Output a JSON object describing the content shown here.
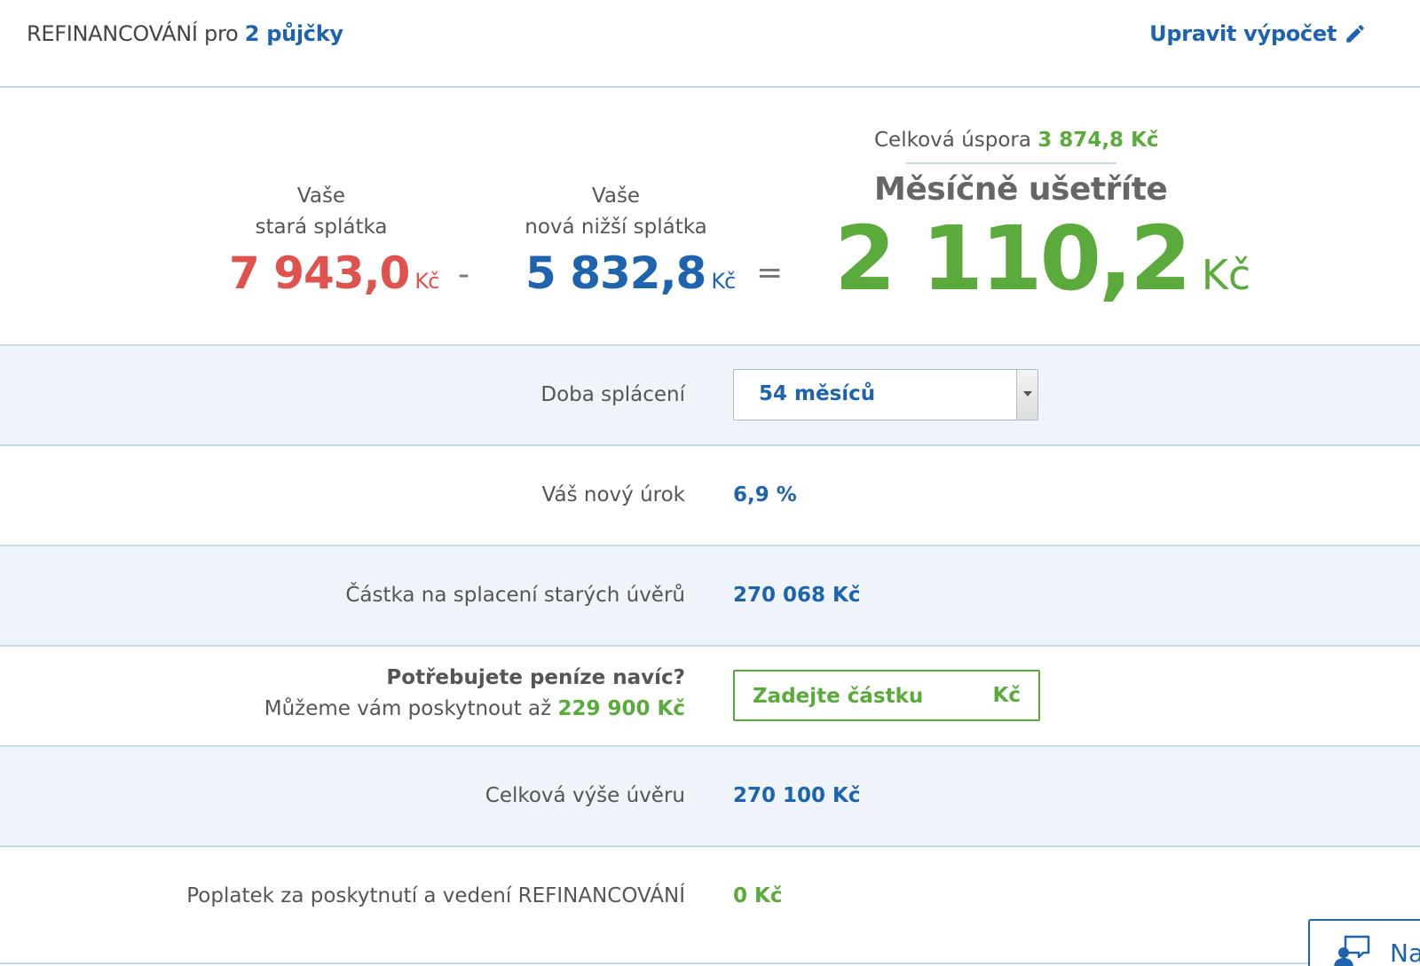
{
  "header": {
    "title_prefix": "REFINANCOVÁNÍ pro",
    "loan_count": "2 půjčky",
    "edit_label": "Upravit výpočet"
  },
  "summary": {
    "old": {
      "label_line1": "Vaše",
      "label_line2": "stará splátka",
      "value": "7 943,0",
      "unit": "Kč"
    },
    "minus": "-",
    "new": {
      "label_line1": "Vaše",
      "label_line2": "nová nižší splátka",
      "value": "5 832,8",
      "unit": "Kč"
    },
    "equals": "=",
    "total_savings_label": "Celková úspora",
    "total_savings_value": "3 874,8 Kč",
    "monthly_label": "Měsíčně ušetříte",
    "monthly_value": "2 110,2",
    "monthly_unit": "Kč"
  },
  "rows": {
    "term": {
      "label": "Doba splácení",
      "selected": "54 měsíců"
    },
    "interest": {
      "label": "Váš nový úrok",
      "value": "6,9 %"
    },
    "payoff": {
      "label": "Částka na splacení starých úvěrů",
      "value": "270 068 Kč"
    },
    "extra": {
      "question": "Potřebujete peníze navíc?",
      "offer_prefix": "Můžeme vám poskytnout až",
      "offer_max": "229 900 Kč",
      "input_placeholder": "Zadejte částku",
      "input_unit": "Kč"
    },
    "total_loan": {
      "label": "Celková výše úvěru",
      "value": "270 100 Kč"
    },
    "fee": {
      "label": "Poplatek za poskytnutí a vedení REFINANCOVÁNÍ",
      "value": "0 Kč"
    }
  },
  "chat": {
    "label": "Na"
  },
  "colors": {
    "blue": "#1e63ad",
    "green": "#5aab3c",
    "red": "#e0524e",
    "row_alt": "#eef4f9",
    "divider": "#c5dbe6"
  }
}
